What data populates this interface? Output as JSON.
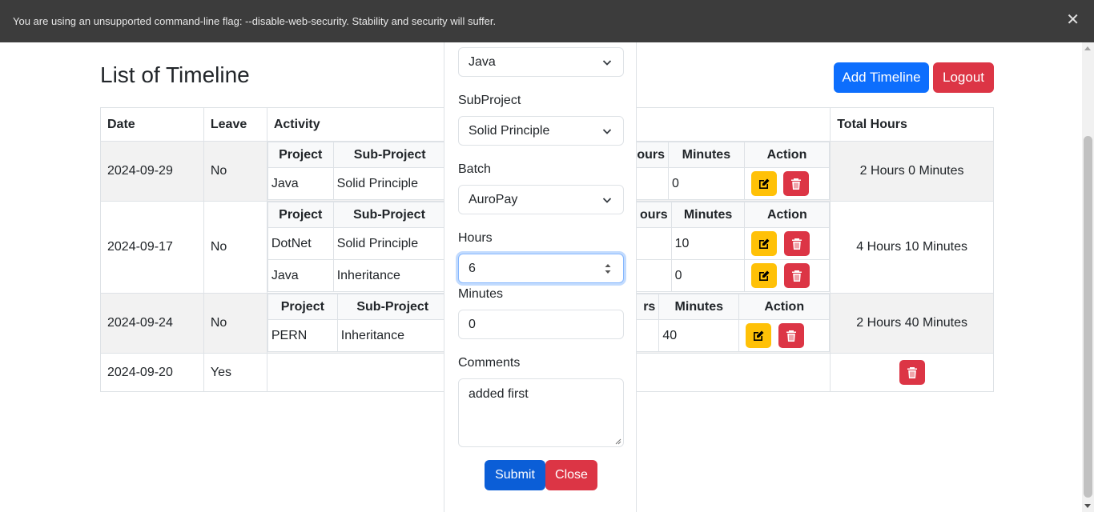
{
  "infobar": {
    "message": "You are using an unsupported command-line flag: --disable-web-security. Stability and security will suffer.",
    "close_glyph": "✕"
  },
  "header": {
    "title": "List of Timeline",
    "add_label": "Add Timeline",
    "logout_label": "Logout"
  },
  "table": {
    "headers": {
      "date": "Date",
      "leave": "Leave",
      "activity": "Activity",
      "total": "Total Hours"
    },
    "inner_headers": {
      "project": "Project",
      "subproject": "Sub-Project",
      "hours_partial": "ours",
      "hours_partial_short": "rs",
      "minutes": "Minutes",
      "action": "Action"
    },
    "rows": [
      {
        "date": "2024-09-29",
        "leave": "No",
        "total": "2 Hours 0 Minutes",
        "activities": [
          {
            "project": "Java",
            "subproject": "Solid Principle",
            "minutes": "0"
          }
        ]
      },
      {
        "date": "2024-09-17",
        "leave": "No",
        "total": "4 Hours 10 Minutes",
        "activities": [
          {
            "project": "DotNet",
            "subproject": "Solid Principle",
            "minutes": "10"
          },
          {
            "project": "Java",
            "subproject": "Inheritance",
            "minutes": "0"
          }
        ]
      },
      {
        "date": "2024-09-24",
        "leave": "No",
        "total": "2 Hours 40 Minutes",
        "activities": [
          {
            "project": "PERN",
            "subproject": "Inheritance",
            "minutes": "40"
          }
        ]
      },
      {
        "date": "2024-09-20",
        "leave": "Yes",
        "total": ""
      }
    ]
  },
  "modal": {
    "project_value": "Java",
    "subproject_label": "SubProject",
    "subproject_value": "Solid Principle",
    "batch_label": "Batch",
    "batch_value": "AuroPay",
    "hours_label": "Hours",
    "hours_value": "6",
    "minutes_label": "Minutes",
    "minutes_value": "0",
    "comments_label": "Comments",
    "comments_value": "added first",
    "submit_label": "Submit",
    "close_label": "Close"
  },
  "colors": {
    "primary": "#0d6efd",
    "danger": "#dc3545",
    "warning": "#ffc107",
    "infobar": "#3c3c3c"
  }
}
